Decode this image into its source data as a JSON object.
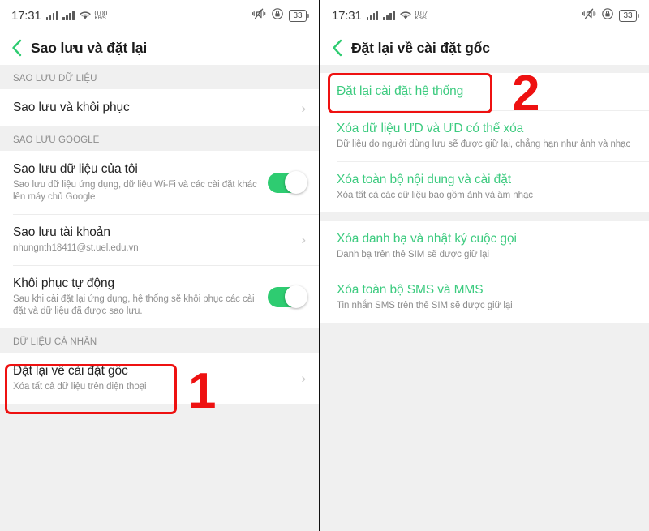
{
  "screens": [
    {
      "id": "backup-and-reset",
      "statusbar": {
        "time": "17:31",
        "net_rate": "0.00",
        "net_unit": "KB/S",
        "battery": "33",
        "icons": [
          "signal-bars-icon",
          "signal-bars-icon",
          "wifi-icon",
          "vibrate-mute-icon",
          "screen-lock-icon",
          "battery-icon"
        ]
      },
      "appbar": {
        "title": "Sao lưu và đặt lại",
        "back": "back-chevron-icon"
      },
      "sections": [
        {
          "header": "SAO LƯU DỮ LIỆU",
          "rows": [
            {
              "title": "Sao lưu và khôi phục",
              "sub": "",
              "accessory": "chevron"
            }
          ]
        },
        {
          "header": "SAO LƯU GOOGLE",
          "rows": [
            {
              "title": "Sao lưu dữ liệu của tôi",
              "sub": "Sao lưu dữ liệu ứng dụng, dữ liệu Wi-Fi và các cài đặt khác lên máy chủ Google",
              "accessory": "toggle",
              "toggle_on": true
            },
            {
              "title": "Sao lưu tài khoản",
              "sub": "nhungnth18411@st.uel.edu.vn",
              "accessory": "chevron"
            },
            {
              "title": "Khôi phục tự động",
              "sub": "Sau khi cài đặt lại ứng dụng, hệ thống sẽ khôi phục các cài đặt và dữ liệu đã được sao lưu.",
              "accessory": "toggle",
              "toggle_on": true
            }
          ]
        },
        {
          "header": "DỮ LIỆU CÁ NHÂN",
          "rows": [
            {
              "title": "Đặt lại về cài đặt gốc",
              "sub": "Xóa tất cả dữ liệu trên điện thoại",
              "accessory": "chevron"
            }
          ]
        }
      ],
      "annotation": {
        "number": "1"
      }
    },
    {
      "id": "factory-reset",
      "statusbar": {
        "time": "17:31",
        "net_rate": "0.07",
        "net_unit": "KB/S",
        "battery": "33",
        "icons": [
          "signal-bars-icon",
          "signal-bars-icon",
          "wifi-icon",
          "vibrate-mute-icon",
          "screen-lock-icon",
          "battery-icon"
        ]
      },
      "appbar": {
        "title": "Đặt lại về cài đặt gốc",
        "back": "back-chevron-icon"
      },
      "options": [
        {
          "title": "Đặt lại cài đặt hệ thống",
          "sub": ""
        },
        {
          "title": "Xóa dữ liệu ƯD và ƯD có thể xóa",
          "sub": "Dữ liệu do người dùng lưu sẽ được giữ lại, chẳng hạn như ảnh và nhạc"
        },
        {
          "title": "Xóa toàn bộ nội dung và cài đặt",
          "sub": "Xóa tất cả các dữ liệu bao gồm ảnh và âm nhạc"
        },
        {
          "title": "Xóa danh bạ và nhật ký cuộc gọi",
          "sub": "Danh bạ trên thẻ SIM sẽ được giữ lại"
        },
        {
          "title": "Xóa toàn bộ SMS và MMS",
          "sub": "Tin nhắn SMS trên thẻ SIM sẽ được giữ lại"
        }
      ],
      "annotation": {
        "number": "2"
      }
    }
  ],
  "colors": {
    "accent_green": "#3ccb7f",
    "toggle_green": "#2ecc71",
    "annotation_red": "#ee1111",
    "page_bg": "#f0f0f0",
    "card_bg": "#ffffff"
  }
}
